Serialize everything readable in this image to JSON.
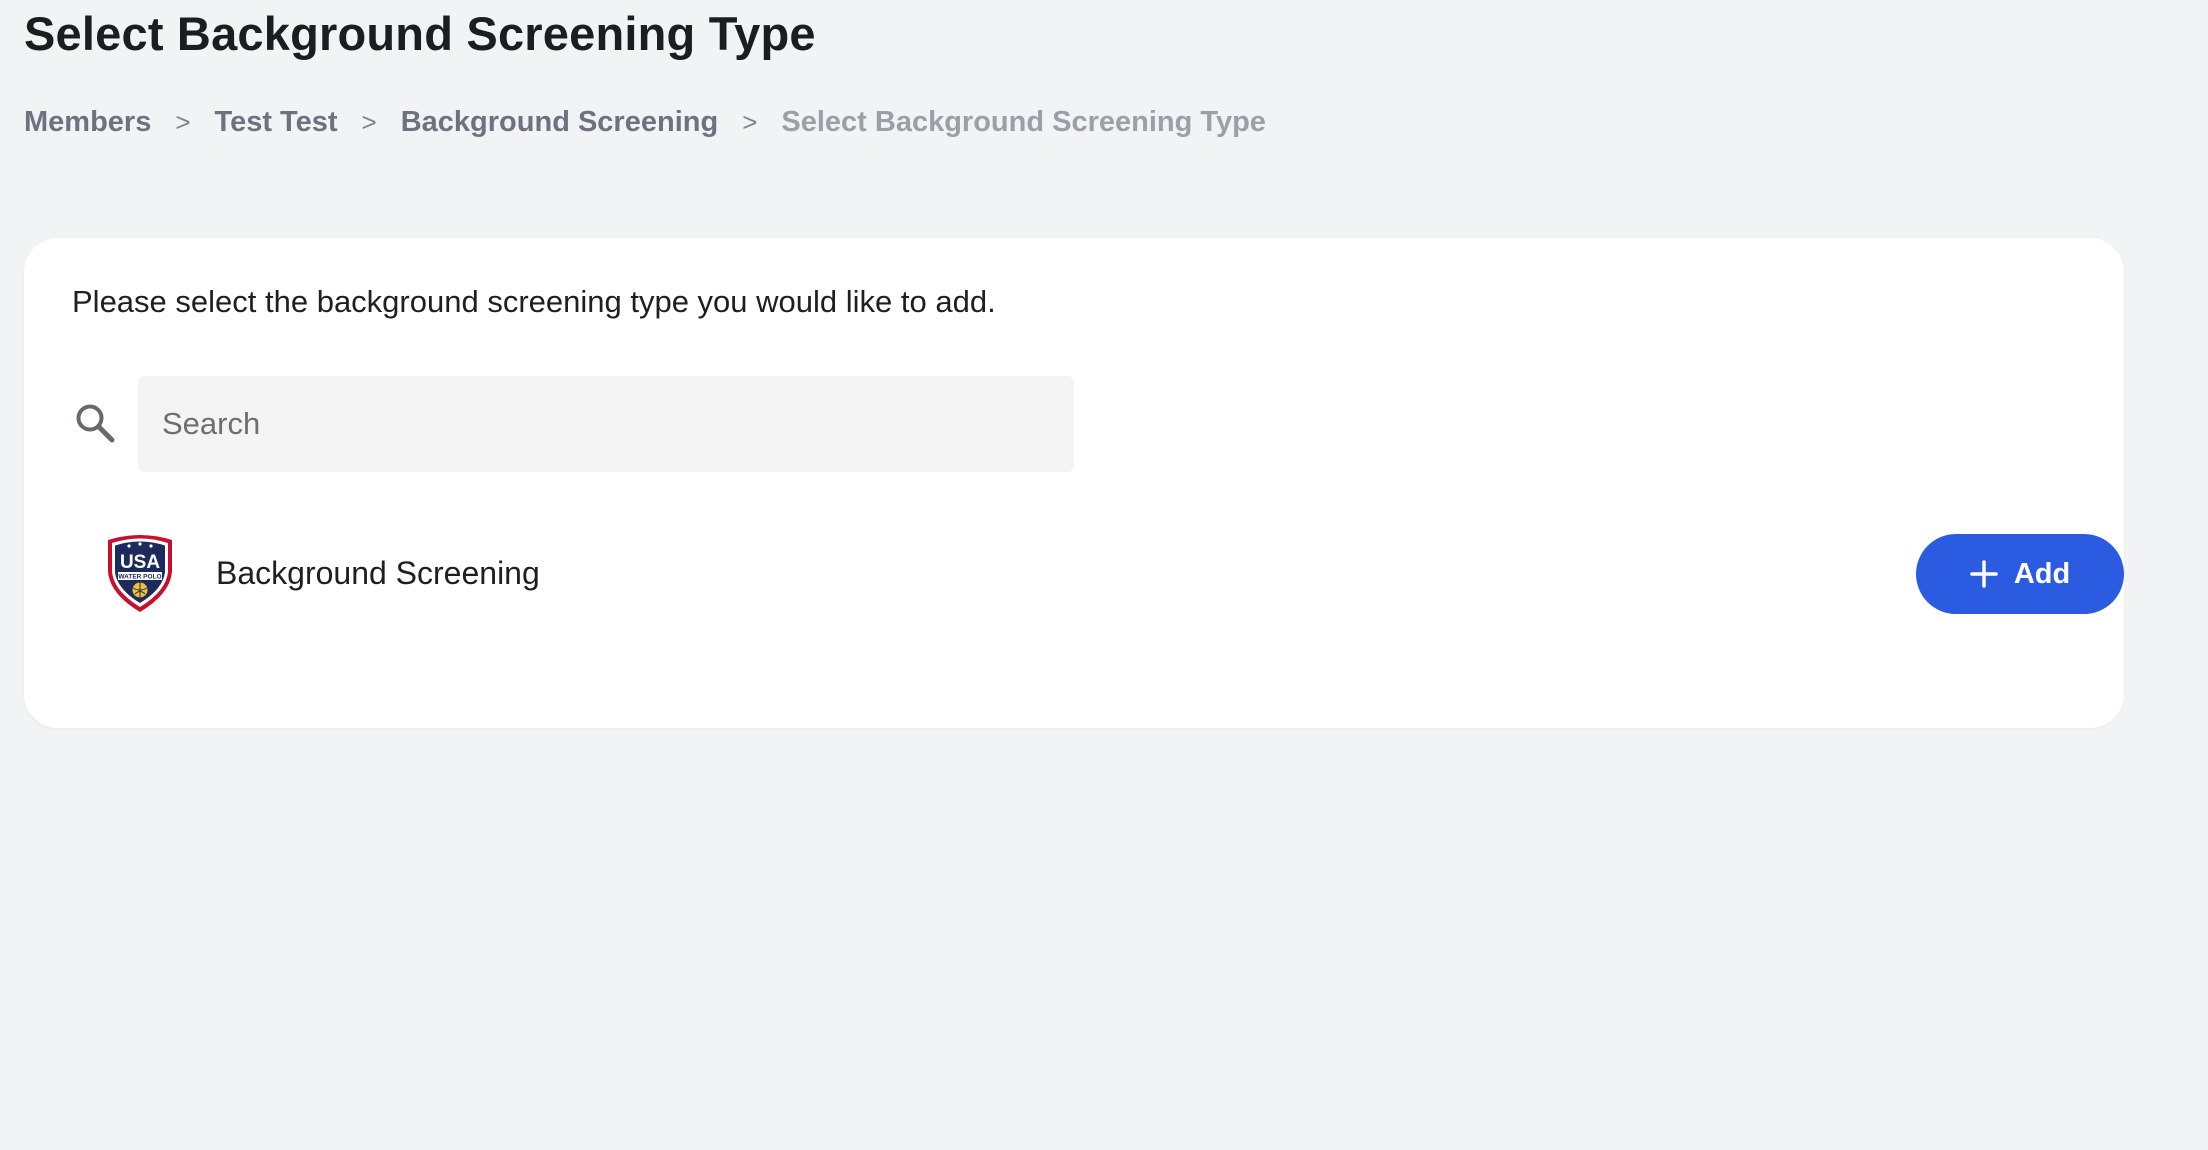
{
  "page": {
    "title": "Select Background Screening Type"
  },
  "breadcrumb": [
    {
      "label": "Members"
    },
    {
      "label": "Test Test"
    },
    {
      "label": "Background Screening"
    },
    {
      "label": "Select Background Screening Type"
    }
  ],
  "breadcrumb_separator": ">",
  "card": {
    "instructions": "Please select the background screening type you would like to add.",
    "search": {
      "placeholder": "Search",
      "value": "",
      "icon": "search-icon"
    },
    "items": [
      {
        "label": "Background Screening",
        "logo_text": "USA",
        "logo_subtext": "WATER POLO",
        "add_label": "Add",
        "add_icon": "plus-icon"
      }
    ]
  },
  "colors": {
    "background": "#f2f3f5",
    "card": "#ffffff",
    "accent": "#2b5be0",
    "breadcrumb_link": "#6c7280",
    "breadcrumb_current": "#9aa0a8",
    "logo_navy": "#1d2a5c",
    "logo_red": "#c8102e"
  }
}
